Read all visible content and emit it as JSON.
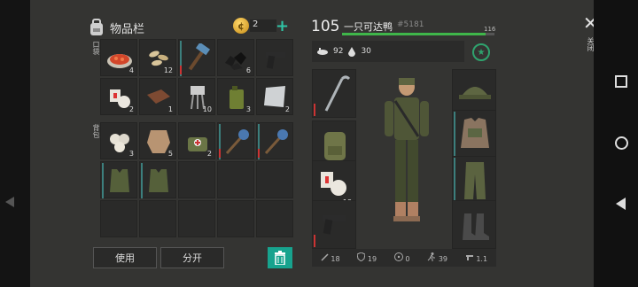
{
  "inventory": {
    "title": "物品栏",
    "coins": "2",
    "tabs": {
      "pocket": "口袋",
      "backpack": "背包"
    },
    "pocket_items": [
      {
        "name": "tomato-stew",
        "count": "4"
      },
      {
        "name": "seeds",
        "count": "12"
      },
      {
        "name": "hammer",
        "count": ""
      },
      {
        "name": "coal",
        "count": "6"
      },
      {
        "name": "pistol",
        "count": ""
      },
      {
        "name": "bandage",
        "count": "2"
      },
      {
        "name": "leather",
        "count": "1"
      },
      {
        "name": "electronic-parts",
        "count": "10"
      },
      {
        "name": "gas-can",
        "count": "3"
      },
      {
        "name": "metal-plate",
        "count": "2"
      }
    ],
    "backpack_items": [
      {
        "name": "dumplings",
        "count": "3"
      },
      {
        "name": "animal-hide",
        "count": "5"
      },
      {
        "name": "medkit-bag",
        "count": "2"
      },
      {
        "name": "spiked-mace",
        "count": ""
      },
      {
        "name": "spiked-mace",
        "count": ""
      },
      {
        "name": "camo-vest",
        "count": ""
      },
      {
        "name": "camo-vest",
        "count": ""
      }
    ],
    "use_label": "使用",
    "split_label": "分开"
  },
  "player": {
    "level": "105",
    "name": "一只可达鸭",
    "id": "#5181",
    "xp_max": "116",
    "xp_fraction": 0.94,
    "food": "92",
    "water": "30"
  },
  "equipment": {
    "left": [
      {
        "name": "crowbar",
        "count": ""
      },
      {
        "name": "backpack",
        "count": ""
      },
      {
        "name": "bandage",
        "count": "18"
      },
      {
        "name": "pistol",
        "count": ""
      }
    ],
    "right": [
      {
        "name": "cap"
      },
      {
        "name": "body-armor"
      },
      {
        "name": "camo-pants"
      },
      {
        "name": "boots-empty"
      }
    ]
  },
  "combat": {
    "attack": "18",
    "defense": "19",
    "radiation": "0",
    "speed": "39",
    "fire_rate": "1.1"
  },
  "close_label": "关闭",
  "colors": {
    "accent": "#17a38e",
    "xp": "#3fb64a",
    "durability": "#cc3333"
  }
}
